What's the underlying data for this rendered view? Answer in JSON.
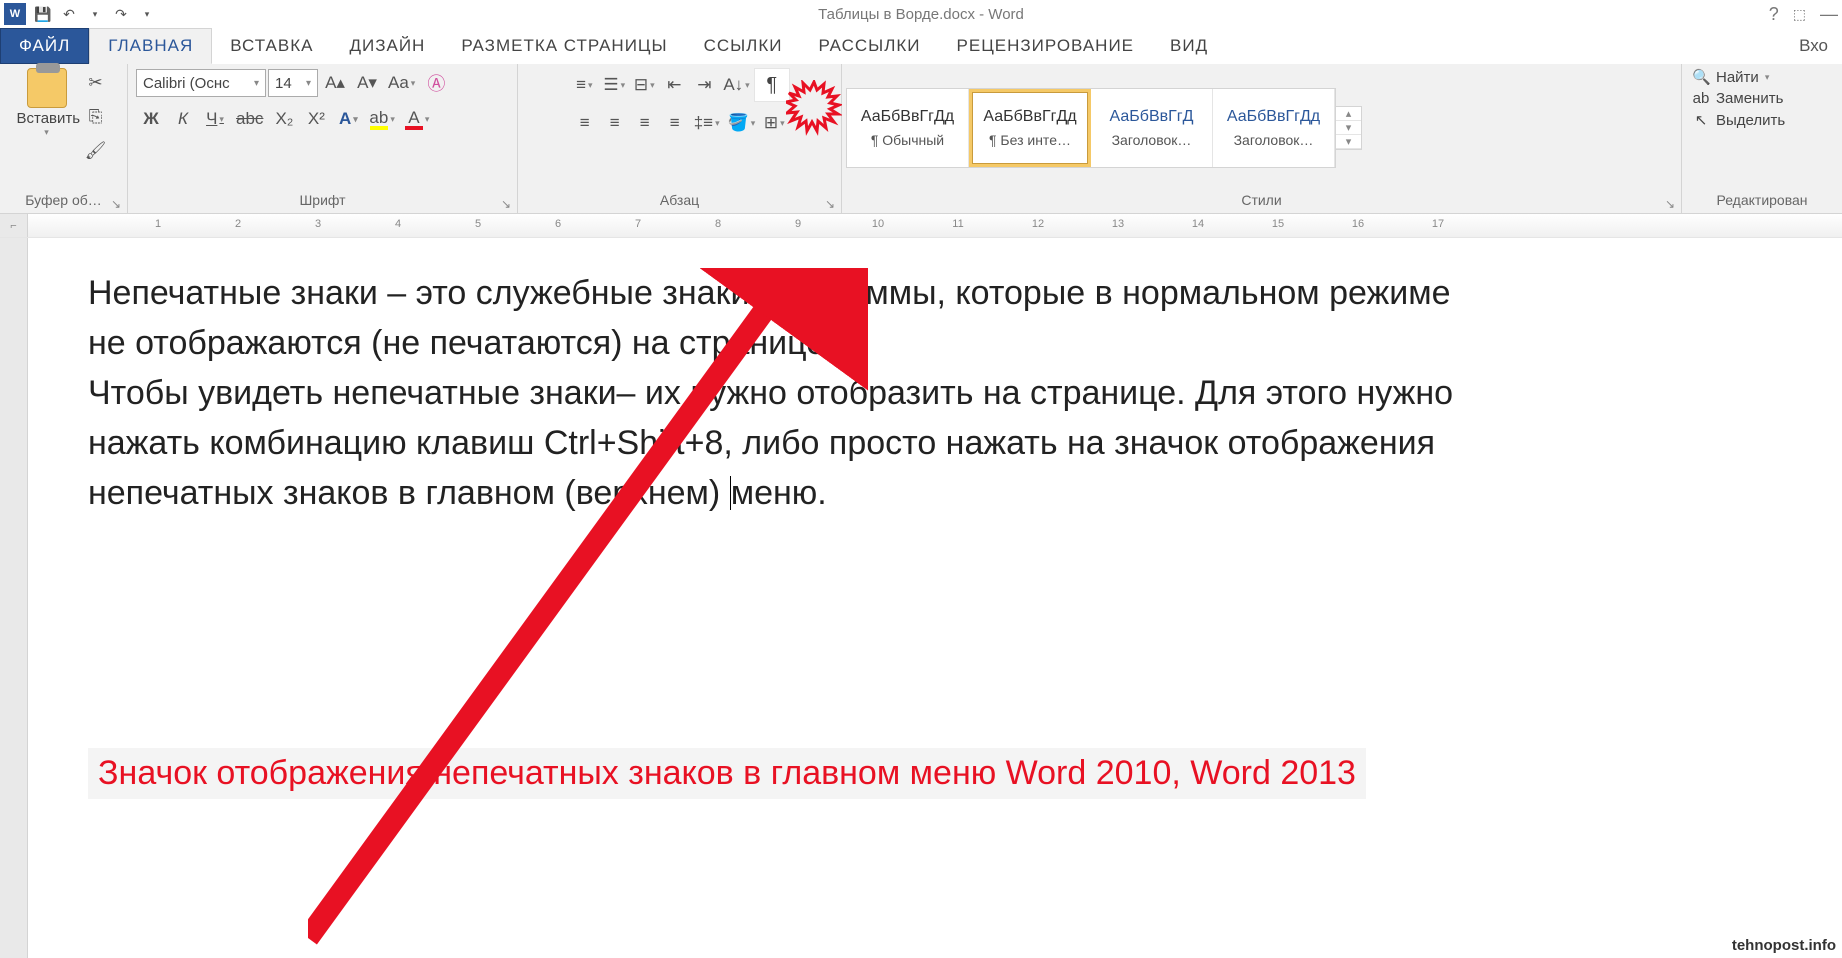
{
  "title": "Таблицы в Ворде.docx - Word",
  "qat": {
    "save": "save-icon",
    "undo": "undo-icon",
    "redo": "redo-icon"
  },
  "tabs": {
    "file": "ФАЙЛ",
    "home": "ГЛАВНАЯ",
    "insert": "ВСТАВКА",
    "design": "ДИЗАЙН",
    "layout": "РАЗМЕТКА СТРАНИЦЫ",
    "refs": "ССЫЛКИ",
    "mail": "РАССЫЛКИ",
    "review": "РЕЦЕНЗИРОВАНИЕ",
    "view": "ВИД",
    "account": "Вхо"
  },
  "clipboard": {
    "paste": "Вставить",
    "label": "Буфер об…"
  },
  "font": {
    "name": "Calibri (Оснс",
    "size": "14",
    "label": "Шрифт",
    "bold": "Ж",
    "italic": "К",
    "underline": "Ч",
    "strike": "abc",
    "sub": "X₂",
    "sup": "X²",
    "effects": "A",
    "clear": "Aa",
    "caseBtn": "Aa"
  },
  "paragraph": {
    "label": "Абзац",
    "pilcrow": "¶"
  },
  "styles": {
    "label": "Стили",
    "items": [
      {
        "preview": "АаБбВвГгДд",
        "name": "¶ Обычный",
        "color": "#333"
      },
      {
        "preview": "АаБбВвГгДд",
        "name": "¶ Без инте…",
        "color": "#333",
        "selected": true
      },
      {
        "preview": "АаБбВвГгД",
        "name": "Заголовок…",
        "color": "#2b579a"
      },
      {
        "preview": "АаБбВвГгДд",
        "name": "Заголовок…",
        "color": "#2b579a"
      }
    ]
  },
  "editing": {
    "find": "Найти",
    "replace": "Заменить",
    "select": "Выделить",
    "label": "Редактирован"
  },
  "ruler": {
    "marks": [
      1,
      2,
      3,
      4,
      5,
      6,
      7,
      8,
      9,
      10,
      11,
      12,
      13,
      14,
      15,
      16,
      17
    ]
  },
  "document": {
    "p1": "Непечатные знаки – это служебные знаки программы, которые в нормальном режиме не отображаются (не печатаются) на странице.",
    "p2a": "Чтобы увидеть непечатные знаки– их нужно отобразить на странице. Для этого нужно нажать комбинацию клавиш Ctrl+Shift+8, либо просто нажать на значок отображения непечатных знаков в главном (верхнем) ",
    "p2b": "меню."
  },
  "caption": "Значок отображения непечатных знаков в главном меню Word 2010, Word   2013",
  "watermark": "tehnopost.info"
}
